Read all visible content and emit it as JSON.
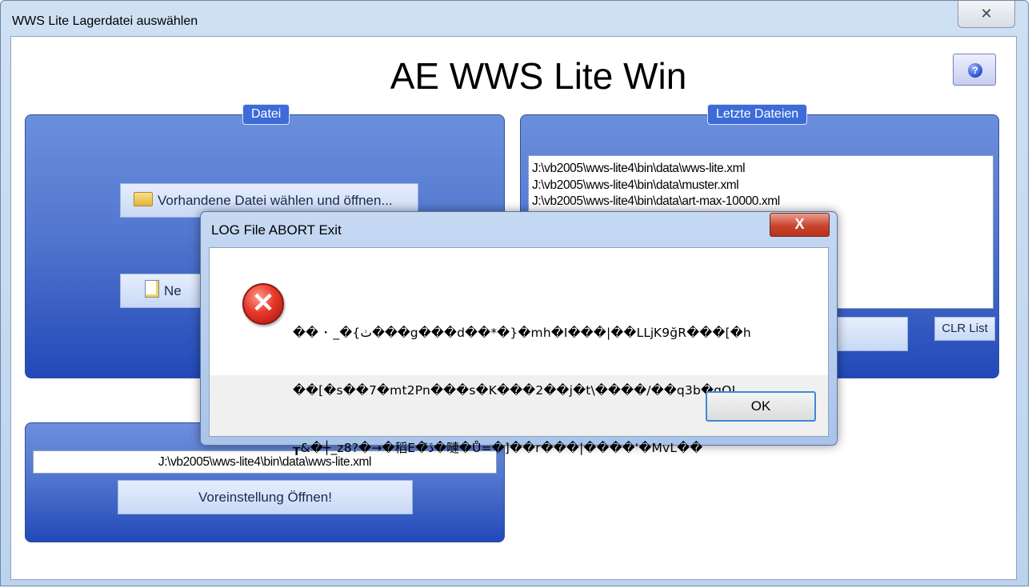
{
  "window": {
    "title": "WWS Lite Lagerdatei auswählen",
    "close_glyph": "✕"
  },
  "app": {
    "title": "AE WWS Lite Win",
    "help_icon": "help-icon"
  },
  "file_panel": {
    "label": "Datei",
    "open_button": "Vorhandene Datei wählen und öffnen...",
    "new_button_partial": "Ne"
  },
  "recent_panel": {
    "label": "Letzte Dateien",
    "items": [
      "J:\\vb2005\\wws-lite4\\bin\\data\\wws-lite.xml",
      "J:\\vb2005\\wws-lite4\\bin\\data\\muster.xml",
      "J:\\vb2005\\wws-lite4\\bin\\data\\art-max-10000.xml"
    ],
    "clr_button": "CLR List"
  },
  "preset_panel": {
    "path_value": "J:\\vb2005\\wws-lite4\\bin\\data\\wws-lite.xml",
    "open_button": "Voreinstellung Öffnen!"
  },
  "dialog": {
    "title": "LOG File ABORT Exit",
    "close_glyph": "X",
    "error_glyph": "✕",
    "message_lines": [
      "�� ･ _�{ٺ���g���d��*�}�mh�I���|��LǈK9ğR���[�h",
      "��[�s��7�mt2Pn���s�K���2��j�t\\����/��q3b�gQI",
      "┰&�┼_z8?�→�稻E�ڏ͂�嗹�Ů=�]��r���|����'�MvL��"
    ],
    "ok_button": "OK"
  }
}
